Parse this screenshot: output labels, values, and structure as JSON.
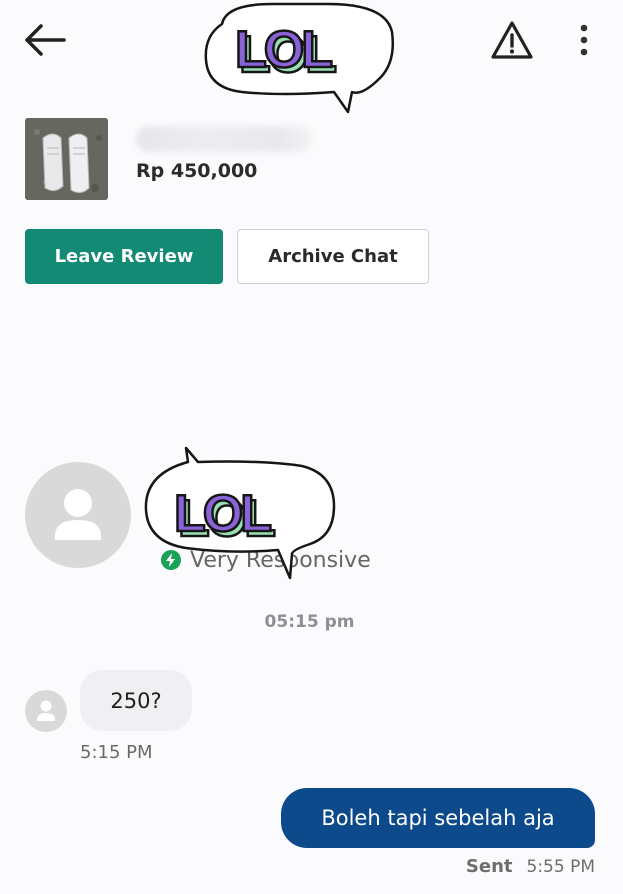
{
  "header": {
    "back_icon": "arrow-left-icon",
    "report_icon": "warning-triangle-icon",
    "menu_icon": "more-vertical-icon"
  },
  "sticker": {
    "text": "LOL",
    "colors": {
      "fill": "#8b63d9",
      "shadow": "#9ae0b5",
      "outline": "#161616"
    }
  },
  "product": {
    "price": "Rp 450,000"
  },
  "actions": {
    "leave_review": "Leave Review",
    "archive_chat": "Archive Chat"
  },
  "seller": {
    "badge_text": "Very Responsive",
    "badge_color": "#1aa15a"
  },
  "chat": {
    "time_separator": "05:15 pm",
    "messages": [
      {
        "direction": "incoming",
        "text": "250?",
        "time": "5:15 PM"
      },
      {
        "direction": "outgoing",
        "text": "Boleh tapi sebelah aja",
        "status": "Sent",
        "time": "5:55 PM"
      }
    ]
  },
  "colors": {
    "primary_green": "#138a74",
    "outgoing_bubble": "#0d4a8c",
    "incoming_bubble": "#f0f0f2"
  }
}
